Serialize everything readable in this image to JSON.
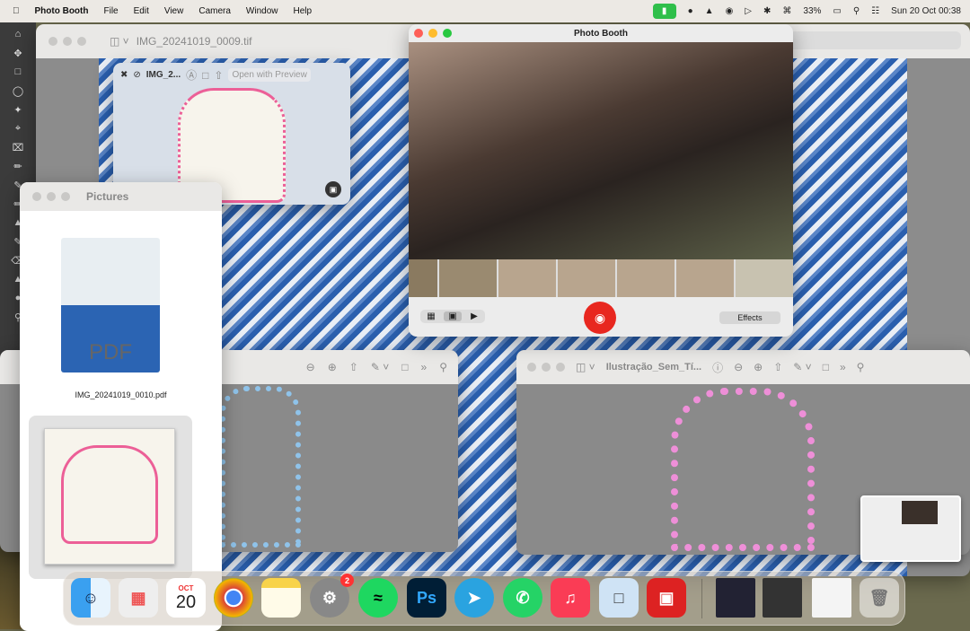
{
  "menubar": {
    "app": "Photo Booth",
    "items": [
      "File",
      "Edit",
      "View",
      "Camera",
      "Window",
      "Help"
    ],
    "battery": "33%",
    "datetime": "Sun 20 Oct  00:38"
  },
  "preview_main": {
    "title": "IMG_20241019_0009.tif"
  },
  "quicklook": {
    "title": "IMG_2...",
    "open_with": "Open with Preview"
  },
  "finder": {
    "title": "Pictures",
    "file1": "IMG_20241019_0010.pdf",
    "pdf_label": "PDF"
  },
  "photobooth": {
    "title": "Photo Booth",
    "effects": "Effects",
    "thumbnail_count": 7
  },
  "preview_right": {
    "title": "Ilustração_Sem_Tí..."
  },
  "dock": {
    "calendar_month": "OCT",
    "calendar_day": "20",
    "settings_badge": "2",
    "apps": [
      "Finder",
      "Launchpad",
      "Calendar",
      "Google Chrome",
      "Notes",
      "System Settings",
      "Spotify",
      "Photoshop",
      "Telegram",
      "WhatsApp",
      "Music",
      "Preview",
      "Photo Booth"
    ],
    "photoshop_label": "Ps"
  }
}
